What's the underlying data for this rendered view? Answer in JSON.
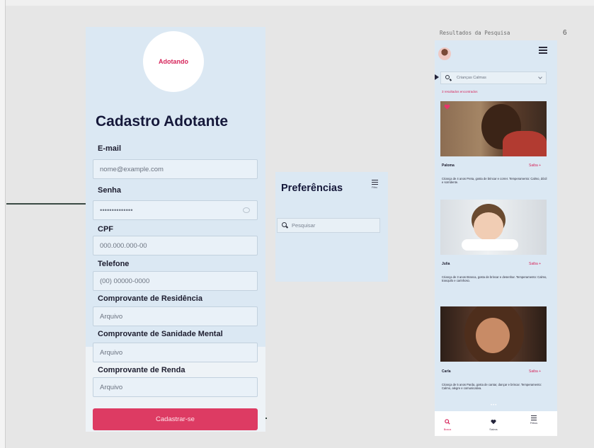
{
  "cadastro": {
    "logo_text": "Adotando",
    "title": "Cadastro Adotante",
    "fields": [
      {
        "label": "E-mail",
        "value": "nome@example.com"
      },
      {
        "label": "Senha",
        "value": "••••••••••••••"
      },
      {
        "label": "CPF",
        "value": "000.000.000-00"
      },
      {
        "label": "Telefone",
        "value": "(00) 00000-0000"
      },
      {
        "label": "Comprovante de Residência",
        "value": "Arquivo"
      },
      {
        "label": "Comprovante de Sanidade Mental",
        "value": "Arquivo"
      },
      {
        "label": "Comprovante de Renda",
        "value": "Arquivo"
      }
    ],
    "submit_label": "Cadastrar-se"
  },
  "preferencias": {
    "title": "Preferências",
    "menu_label": "Filtro",
    "search_placeholder": "Pesquisar"
  },
  "resultados": {
    "caption": "Resultados da Pesquisa",
    "frame_number": "6",
    "search_value": "Crianças Calmas",
    "result_count": "3 resultados encontrados",
    "cards": [
      {
        "name": "Paloma",
        "link": "Saiba +",
        "description": "Criança de 4 anos Preta, gosta de brincar e correr. Temperamento: Calmo, dócil e sorridente."
      },
      {
        "name": "Julia",
        "link": "Saiba +",
        "description": "Criança de 3 anos Branca, gosta de brincar e desenhar. Temperamento: Calmo, tranquilo e carinhoso."
      },
      {
        "name": "Carla",
        "link": "Saiba +",
        "description": "Criança de 5 anos Parda, gosta de cantar, dançar e brincar. Temperamento: Calmo, alegre e comunicativa."
      }
    ],
    "nav": [
      {
        "label": "Busca",
        "icon": "search-icon"
      },
      {
        "label": "Salvos",
        "icon": "heart-icon"
      },
      {
        "label": "Filtros",
        "icon": "filter-icon"
      }
    ]
  },
  "colors": {
    "accent": "#dd3b63",
    "frame_bg": "#dbe8f3",
    "title": "#15183a"
  }
}
